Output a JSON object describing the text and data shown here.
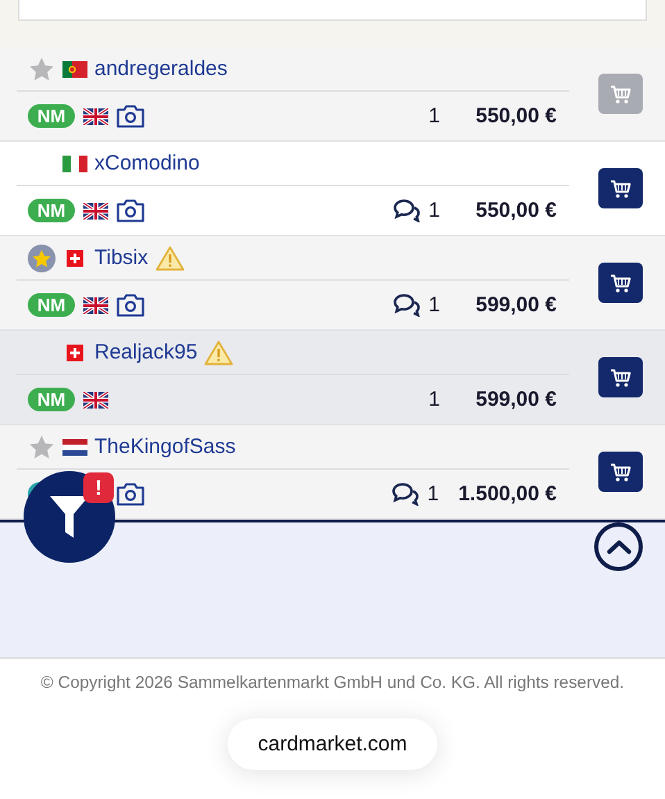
{
  "offers": [
    {
      "badge": {
        "kind": "star"
      },
      "country": {
        "kind": "pt"
      },
      "seller": "andregeraldes",
      "warning": false,
      "condition": {
        "label": "NM",
        "color": "#3dae4f"
      },
      "language": {
        "kind": "en"
      },
      "photo": true,
      "comment": false,
      "quantity": "1",
      "price": "550,00 €",
      "cart_disabled": true,
      "highlighted": false
    },
    {
      "country": {
        "kind": "it"
      },
      "seller": "xComodino",
      "warning": false,
      "condition": {
        "label": "NM",
        "color": "#3dae4f"
      },
      "language": {
        "kind": "en"
      },
      "photo": true,
      "comment": true,
      "quantity": "1",
      "price": "550,00 €",
      "cart_disabled": false,
      "highlighted": false
    },
    {
      "badge": {
        "kind": "top"
      },
      "country": {
        "kind": "ch"
      },
      "seller": "Tibsix",
      "warning": true,
      "condition": {
        "label": "NM",
        "color": "#3dae4f"
      },
      "language": {
        "kind": "en"
      },
      "photo": true,
      "comment": true,
      "quantity": "1",
      "price": "599,00 €",
      "cart_disabled": false,
      "highlighted": false
    },
    {
      "country": {
        "kind": "ch"
      },
      "seller": "Realjack95",
      "warning": true,
      "condition": {
        "label": "NM",
        "color": "#3dae4f"
      },
      "language": {
        "kind": "en"
      },
      "photo": false,
      "comment": false,
      "quantity": "1",
      "price": "599,00 €",
      "cart_disabled": false,
      "highlighted": true
    },
    {
      "badge": {
        "kind": "star"
      },
      "country": {
        "kind": "nl"
      },
      "seller": "TheKingofSass",
      "warning": false,
      "condition": {
        "color": "#2aa3ab"
      },
      "photo": true,
      "comment": true,
      "quantity": "1",
      "price": "1.500,00 €",
      "cart_disabled": false,
      "highlighted": false
    }
  ],
  "filter_alert": "!",
  "footer": {
    "copyright": "© Copyright 2026 Sammelkartenmarkt GmbH und Co. KG. All rights reserved.",
    "domain": "cardmarket.com"
  }
}
